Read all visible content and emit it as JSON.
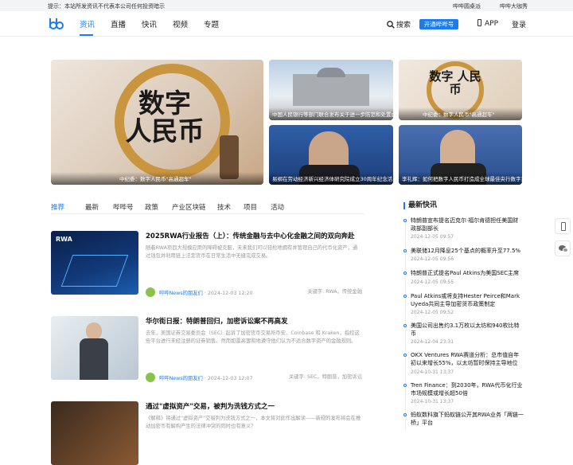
{
  "topbar": {
    "tip": "提示：本站所发资讯不代表本公司任何投资暗示",
    "links": [
      "哔哔圆桌派",
      "哔哔大咖秀"
    ]
  },
  "nav": {
    "items": [
      "资讯",
      "直播",
      "快讯",
      "视频",
      "专题"
    ],
    "active": "资讯",
    "search": "搜索",
    "open_button": "开通哔哔号",
    "app": "APP",
    "login": "登录"
  },
  "banners": {
    "big": {
      "caption": "中纪委：数字人民币\"高通超车\"",
      "art": "数字 人民币"
    },
    "b1": {
      "caption": "中国人民银行等部门联合发布关于进一步防范和处置虚..."
    },
    "b2": {
      "caption": "中纪委：数字人民币\"高通超车\"",
      "art": "数字 人民币"
    },
    "b3": {
      "caption": "易纲在劳动经济新兴经济体研究院成立30周年纪念活..."
    },
    "b4": {
      "caption": "李礼辉：如何把数字人民币打造成全球最佳央行数字货..."
    }
  },
  "tabs": [
    "推荐",
    "最新",
    "哔哔号",
    "政策",
    "产业区块链",
    "技术",
    "项目",
    "活动"
  ],
  "articles": [
    {
      "title": "2025RWA行业报告（上）：传统金融与去中心化金融之间的双向奔赴",
      "desc": "随着RWA项目大规模应用的障碍被克服，未来我们可以轻松地拥有并管理自己的代币化资产，通过钱包并利用链上法定货币在日常生活中无缝完成交易。",
      "author": "哔哔News的朋友们",
      "time": "· 2024-12-03 12:20",
      "keywords": "关键字: RWA，传统金融",
      "thumb_label": "RWA"
    },
    {
      "title": "华尔街日报：特朗普回归，加密诉讼案不再高发",
      "desc": "去年，美国证券交易委员会（SEC）起诉了加密货币交易所币安、Coinbase 和 Kraken，指控这些平台进行未经注册的证券销售。然而如雷高罢和地遵守他们认为不适合数字资产的金融规则。",
      "author": "哔哔News的朋友们",
      "time": "· 2024-12-03 12:07",
      "keywords": "关键字: SEC，特朗普，加密诉讼"
    },
    {
      "title": "通过\"虚拟资产\"交易，被判为洗钱方式之一",
      "desc": "《解释》将通过\"虚拟资产\"交易列为洗钱方式之一，本文将对此作出解读——新规的发布将会在推动加密币有解构产生的法律冲突的同时也有意义？",
      "author": "",
      "time": "",
      "keywords": ""
    }
  ],
  "sidebar": {
    "heading": "最新快讯",
    "news": [
      {
        "title": "特朗普宣布提名迈克尔·福尔肯德担任美国财政部副部长",
        "date": "2024-12-05 09:57"
      },
      {
        "title": "美联储12月降息25个基点的概率升至77.5%",
        "date": "2024-12-05 09:56"
      },
      {
        "title": "特朗普正式提名Paul Atkins为美国SEC主席",
        "date": "2024-12-05 09:55"
      },
      {
        "title": "Paul Atkins或将支持Hester Peirce和Mark Uyeda共同主导加密货币政策制定",
        "date": "2024-12-05 09:52"
      },
      {
        "title": "美国公司出售约3.1万枚以太坊和940枚比特币",
        "date": "2024-12-04 23:31"
      },
      {
        "title": "OKX Ventures RWA赛道分析：总市值自年初以来增长55%，以太坊暂时保持主导地位",
        "date": "2024-10-31 13:37"
      },
      {
        "title": "Tren Finance：到2030年，RWA代币化行业市场规模或增长超50倍",
        "date": "2024-10-31 13:37"
      },
      {
        "title": "蚂蚁数科旗下蚂蚁链公开其RWA业务「两链一桥」平台",
        "date": ""
      }
    ]
  },
  "colors": {
    "accent": "#1a7cf0"
  }
}
